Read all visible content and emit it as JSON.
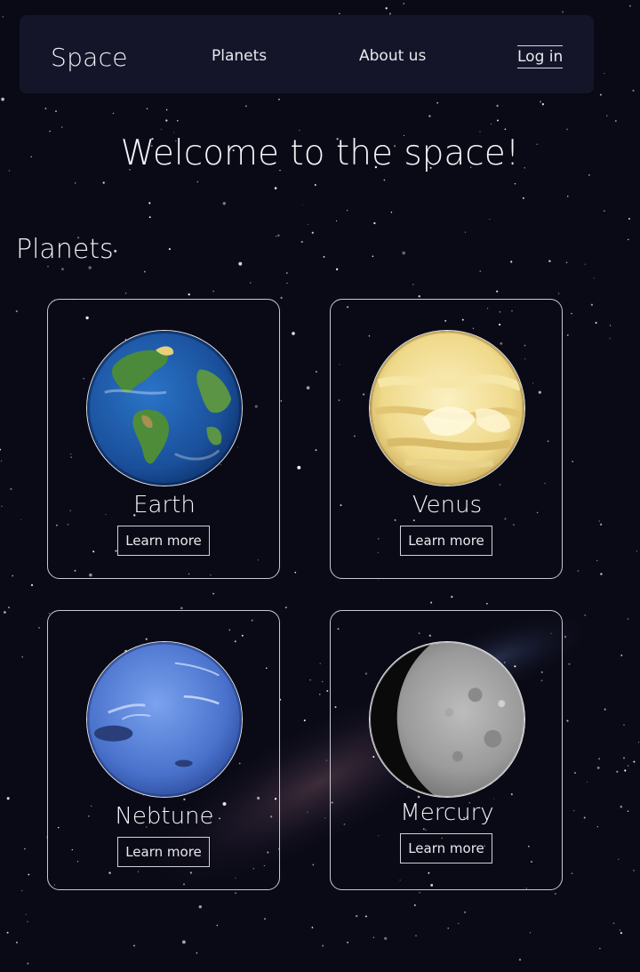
{
  "nav": {
    "brand": "Space",
    "links": [
      "Planets",
      "About us"
    ],
    "login": "Log in"
  },
  "hero": {
    "title": "Welcome to the space!"
  },
  "planets_section": {
    "title": "Planets",
    "cards": [
      {
        "name": "Earth",
        "button": "Learn more",
        "icon": "earth-globe"
      },
      {
        "name": "Venus",
        "button": "Learn more",
        "icon": "venus-planet"
      },
      {
        "name": "Nebtune",
        "button": "Learn more",
        "icon": "neptune-planet"
      },
      {
        "name": "Mercury",
        "button": "Learn more",
        "icon": "mercury-planet"
      }
    ]
  },
  "colors": {
    "background": "#0a0a16",
    "navbar": "#15152a",
    "text": "#f2f2f6",
    "card_border": "#c8c8d4"
  }
}
